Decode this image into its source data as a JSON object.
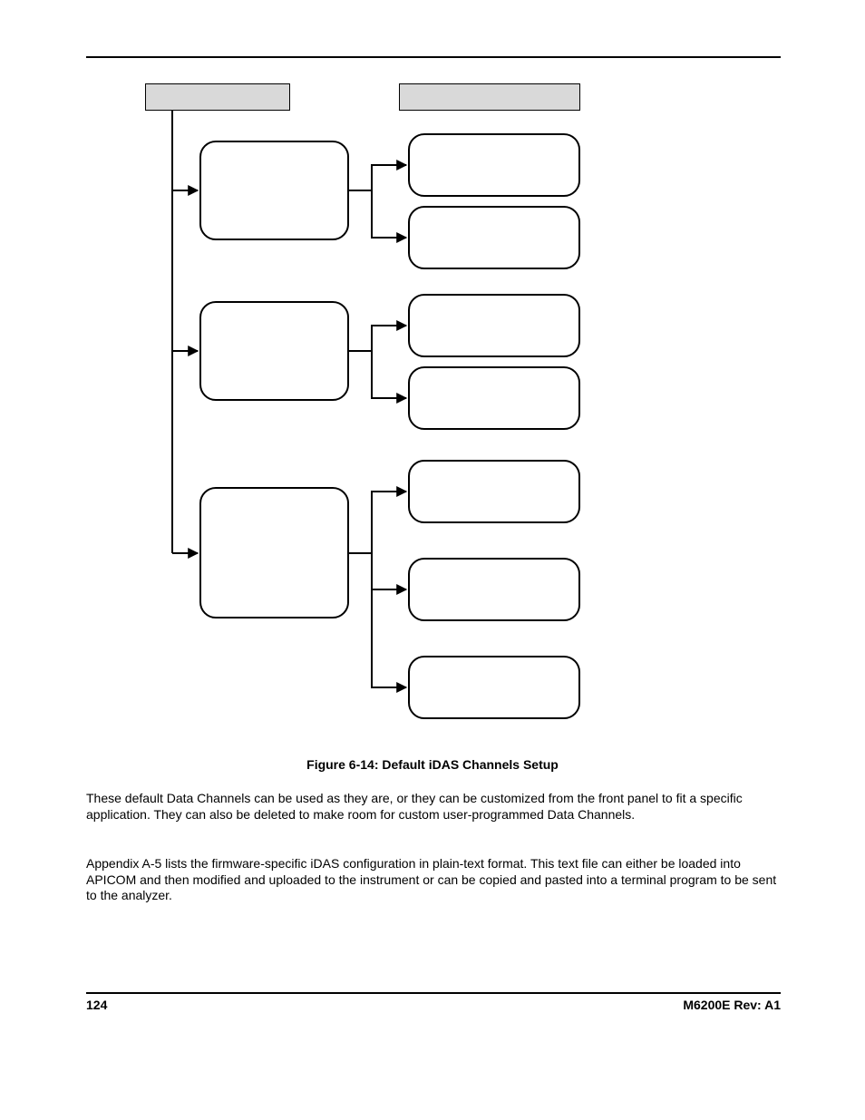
{
  "footer": {
    "page_number": "124",
    "revision": "M6200E Rev: A1"
  },
  "figure": {
    "caption": "Figure 6-14:   Default iDAS Channels Setup"
  },
  "paragraphs": {
    "p1": "These default Data Channels can be used as they are, or they can be customized from the front panel to fit a specific application. They can also be deleted to make room for custom user-programmed Data Channels.",
    "p2": "Appendix A-5 lists the firmware-specific iDAS configuration in plain-text format. This text file can either be loaded into APICOM and then modified and uploaded to the instrument or can be copied and pasted into a terminal program to be sent to the analyzer."
  },
  "diagram": {
    "headers": {
      "left": "",
      "right": ""
    },
    "channels": [
      {
        "name": "",
        "params": [
          "",
          ""
        ]
      },
      {
        "name": "",
        "params": [
          "",
          ""
        ]
      },
      {
        "name": "",
        "params": [
          "",
          "",
          ""
        ]
      }
    ]
  }
}
